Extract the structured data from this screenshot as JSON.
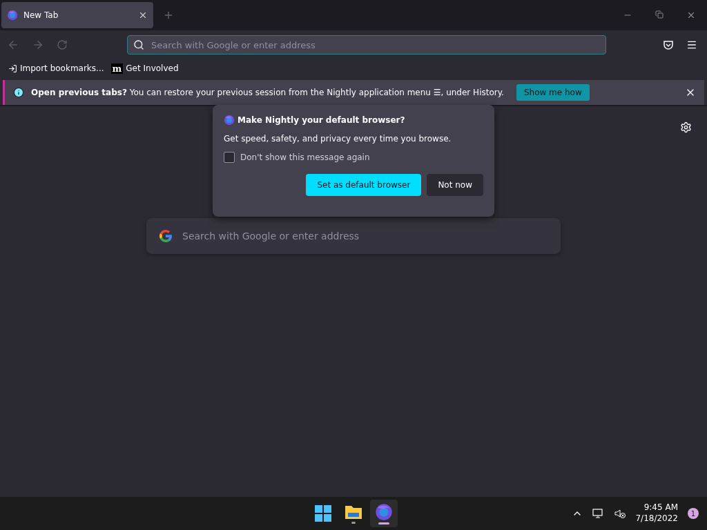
{
  "tabs": [
    {
      "title": "New Tab",
      "selected": true
    }
  ],
  "toolbar": {
    "url_placeholder": "Search with Google or enter address"
  },
  "bookmarks": [
    {
      "label": "Import bookmarks...",
      "kind": "import"
    },
    {
      "label": "Get Involved",
      "kind": "site",
      "icon_text": "m"
    }
  ],
  "notification": {
    "message": "**Open previous tabs?** You can restore your previous session from the Nightly application menu ☰, under History.",
    "button": "Show me how"
  },
  "popup": {
    "title": "Make Nightly your default browser?",
    "body": "Get speed, safety, and privacy every time you browse.",
    "checkbox": {
      "label": "Don't show this message again",
      "checked": false
    },
    "primary_button": "Set as default browser",
    "secondary_button": "Not now"
  },
  "content": {
    "search_placeholder": "Search with Google or enter address"
  },
  "taskbar": {
    "apps": [
      {
        "kind": "start",
        "selected": false,
        "running": false
      },
      {
        "kind": "files",
        "selected": false,
        "running": true
      },
      {
        "kind": "browser",
        "selected": true,
        "running": true
      }
    ],
    "time": "9:45 AM",
    "date": "7/18/2022",
    "badge": "1"
  }
}
